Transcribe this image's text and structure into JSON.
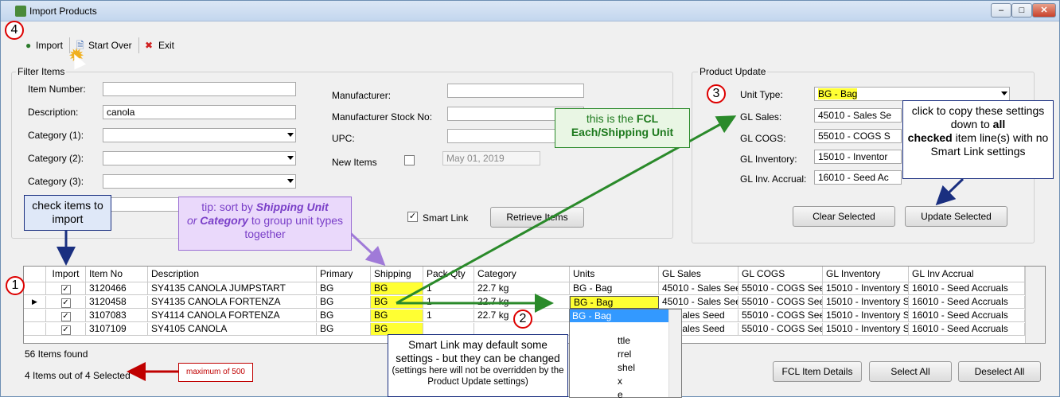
{
  "window": {
    "title": "Import Products"
  },
  "toolbar": {
    "import": "Import",
    "start_over": "Start Over",
    "exit": "Exit"
  },
  "filter": {
    "legend": "Filter Items",
    "item_number_label": "Item Number:",
    "item_number": "",
    "description_label": "Description:",
    "description": "canola",
    "category1_label": "Category (1):",
    "category2_label": "Category (2):",
    "category3_label": "Category (3):",
    "manufacturer_label": "Manufacturer:",
    "mfr_stock_label": "Manufacturer Stock No:",
    "upc_label": "UPC:",
    "new_items_label": "New Items",
    "new_items_date": "May 01, 2019",
    "smart_link_label": "Smart Link",
    "retrieve_button": "Retrieve Items"
  },
  "product_update": {
    "legend": "Product Update",
    "unit_type_label": "Unit Type:",
    "unit_type": "BG - Bag",
    "gl_sales_label": "GL Sales:",
    "gl_sales": "45010 - Sales Se",
    "gl_cogs_label": "GL COGS:",
    "gl_cogs": "55010 - COGS S",
    "gl_inventory_label": "GL Inventory:",
    "gl_inventory": "15010 - Inventor",
    "gl_inv_accrual_label": "GL Inv. Accrual:",
    "gl_inv_accrual": "16010 - Seed Ac",
    "clear_button": "Clear Selected",
    "update_button": "Update Selected"
  },
  "grid": {
    "headers": [
      "Import",
      "Item No",
      "Description",
      "Primary",
      "Shipping",
      "Pack Qty",
      "Category",
      "Units",
      "GL Sales",
      "GL COGS",
      "GL Inventory",
      "GL Inv Accrual"
    ],
    "rows": [
      {
        "item": "3120466",
        "desc": "SY4135 CANOLA JUMPSTART",
        "primary": "BG",
        "shipping": "BG",
        "pack": "1",
        "category": "22.7 kg",
        "units": "BG - Bag",
        "sales": "45010 - Sales Seed",
        "cogs": "55010 - COGS See",
        "inv": "15010 - Inventory S",
        "accrual": "16010 - Seed Accruals"
      },
      {
        "item": "3120458",
        "desc": "SY4135 CANOLA FORTENZA",
        "primary": "BG",
        "shipping": "BG",
        "pack": "1",
        "category": "22.7 kg",
        "units": "BG - Bag",
        "sales": "45010 - Sales Seed",
        "cogs": "55010 - COGS See",
        "inv": "15010 - Inventory S",
        "accrual": "16010 - Seed Accruals"
      },
      {
        "item": "3107083",
        "desc": "SY4114 CANOLA FORTENZA",
        "primary": "BG",
        "shipping": "BG",
        "pack": "1",
        "category": "22.7 kg",
        "units": "",
        "sales": "0 - Sales Seed",
        "cogs": "55010 - COGS See",
        "inv": "15010 - Inventory S",
        "accrual": "16010 - Seed Accruals"
      },
      {
        "item": "3107109",
        "desc": "SY4105 CANOLA",
        "primary": "BG",
        "shipping": "BG",
        "pack": "",
        "category": "",
        "units": "",
        "sales": "0 - Sales Seed",
        "cogs": "55010 - COGS See",
        "inv": "15010 - Inventory S",
        "accrual": "16010 - Seed Accruals"
      }
    ],
    "units_options": [
      "BG - Bag",
      "ttle",
      "rrel",
      "shel",
      "x",
      "e"
    ]
  },
  "status": {
    "found": "56 Items found",
    "selected": "4 Items out of 4 Selected"
  },
  "bottom_buttons": {
    "details": "FCL Item Details",
    "select_all": "Select All",
    "deselect_all": "Deselect All"
  },
  "callouts": {
    "check_items": "check items to import",
    "tip_pre": "tip: sort by ",
    "tip_ship": "Shipping Unit",
    "tip_or": "or ",
    "tip_cat": "Category",
    "tip_post": " to group unit types together",
    "fcl_pre": "this is the ",
    "fcl_bold1": "FCL",
    "fcl_bold2": "Each/Shipping Unit",
    "copy_pre": "click to copy these settings down to ",
    "copy_all": "all",
    "copy_checked": "checked",
    "copy_post": " item line(s) with no Smart Link settings",
    "smart_main": "Smart Link may default some settings - but they can be changed",
    "smart_sub": "(settings here will not be overridden by the Product Update settings)",
    "max": "maximum of 500"
  },
  "numbers": {
    "n1": "1",
    "n2": "2",
    "n3": "3",
    "n4": "4"
  },
  "colors": {
    "highlight": "#ffff33",
    "callout_green": "#2a8a2a",
    "callout_purple": "#9b6fd4",
    "callout_blue": "#1a2f80",
    "callout_red": "#c00000"
  }
}
